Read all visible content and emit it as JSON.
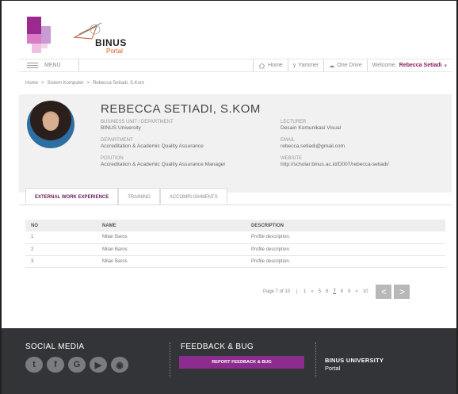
{
  "header": {
    "logo_text": "BINUS",
    "logo_sub": "Portal"
  },
  "nav": {
    "menu_label": "MENU",
    "home_label": "Home",
    "yammer_label": "Yammer",
    "onedrive_label": "One Drive",
    "welcome_prefix": "Welcome,",
    "welcome_user": "Rebecca Setiadi",
    "caret": "▾"
  },
  "breadcrumb": {
    "items": [
      "Home",
      "Sistem Komputer",
      "Rebecca Setiadi, S.Kom"
    ],
    "separator": ">"
  },
  "profile": {
    "name": "REBECCA SETIADI, S.KOM",
    "business_unit": {
      "label": "BUSINESS UNIT / DEPARTMENT",
      "value": "BINUS University"
    },
    "department": {
      "label": "DEPARTMENT",
      "value": "Accreditation & Academic Quality Assurance"
    },
    "position": {
      "label": "POSITION",
      "value": "Accreditation & Academic Quality Assurance Manager"
    },
    "lecturer": {
      "label": "LECTURER",
      "value": "Desain Komunikasi Visual"
    },
    "email": {
      "label": "EMAIL",
      "value": "rebecca.setiadi@gmail.com"
    },
    "website": {
      "label": "WEBSITE",
      "value": "http://scholar.binus.ac.id/D007/rebecca-setiadi/"
    }
  },
  "tabs": [
    {
      "label": "EXTERNAL WORK EXPERIENCE",
      "active": true
    },
    {
      "label": "TRAINING",
      "active": false
    },
    {
      "label": "ACCOMPLISHMENTS",
      "active": false
    }
  ],
  "table": {
    "headers": [
      "NO",
      "NAME",
      "DESCRIPTION"
    ],
    "rows": [
      [
        "1",
        "Milan Baros",
        "Profile description."
      ],
      [
        "2",
        "Milan Baros",
        "Profile description."
      ],
      [
        "3",
        "Milan Baros",
        "Profile description."
      ]
    ]
  },
  "pagination": {
    "info": "Page 7 of 10",
    "links": [
      "1",
      "«",
      "5",
      "6",
      "7",
      "8",
      "9",
      "»",
      "10"
    ],
    "current": "7",
    "prev": "<",
    "next": ">"
  },
  "footer": {
    "social_title": "SOCIAL MEDIA",
    "social_icons": [
      "twitter-icon",
      "facebook-icon",
      "google-plus-icon",
      "youtube-icon",
      "rss-icon"
    ],
    "social_glyphs": [
      "t",
      "f",
      "G",
      "▶",
      "◉"
    ],
    "feedback_title": "FEEDBACK & BUG",
    "report_button": "REPORT FEEDBACK & BUG",
    "university": "BINUS UNIVERSITY",
    "portal": "Portal"
  },
  "colors": {
    "brand": "#8d2c8f",
    "footer_bg": "#333437",
    "accent_orange": "#e05a1e"
  }
}
